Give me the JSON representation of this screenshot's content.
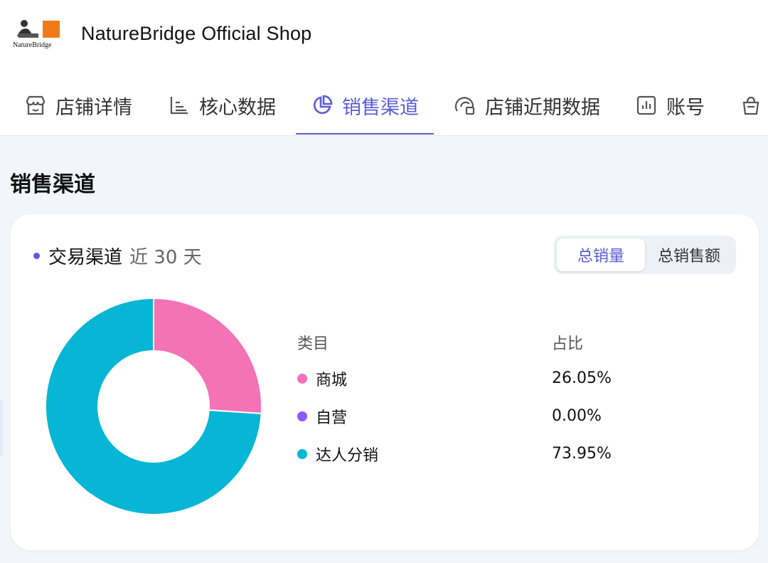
{
  "header": {
    "shop_name": "NatureBridge Official Shop",
    "logo_text": "NatureBridge"
  },
  "tabs": [
    {
      "label": "店铺详情",
      "icon": "store-icon",
      "active": false
    },
    {
      "label": "核心数据",
      "icon": "bar-chart-icon",
      "active": false
    },
    {
      "label": "销售渠道",
      "icon": "pie-chart-icon",
      "active": true
    },
    {
      "label": "店铺近期数据",
      "icon": "analytics-icon",
      "active": false
    },
    {
      "label": "账号",
      "icon": "account-chart-icon",
      "active": false
    }
  ],
  "section": {
    "title": "销售渠道"
  },
  "card": {
    "title": "交易渠道",
    "period": "近 30 天",
    "toggle": [
      {
        "label": "总销量",
        "active": true
      },
      {
        "label": "总销售额",
        "active": false
      }
    ]
  },
  "legend": {
    "col_category": "类目",
    "col_share": "占比"
  },
  "colors": {
    "accent": "#5b5bd6",
    "mall": "#f472b6",
    "self": "#8b5cf6",
    "creator": "#06b6d4"
  },
  "chart_data": {
    "type": "pie",
    "categories": [
      "商城",
      "自营",
      "达人分销"
    ],
    "values": [
      26.05,
      0.0,
      73.95
    ],
    "labels": [
      "26.05%",
      "0.00%",
      "73.95%"
    ],
    "colors": [
      "#f472b6",
      "#8b5cf6",
      "#06b6d4"
    ]
  }
}
